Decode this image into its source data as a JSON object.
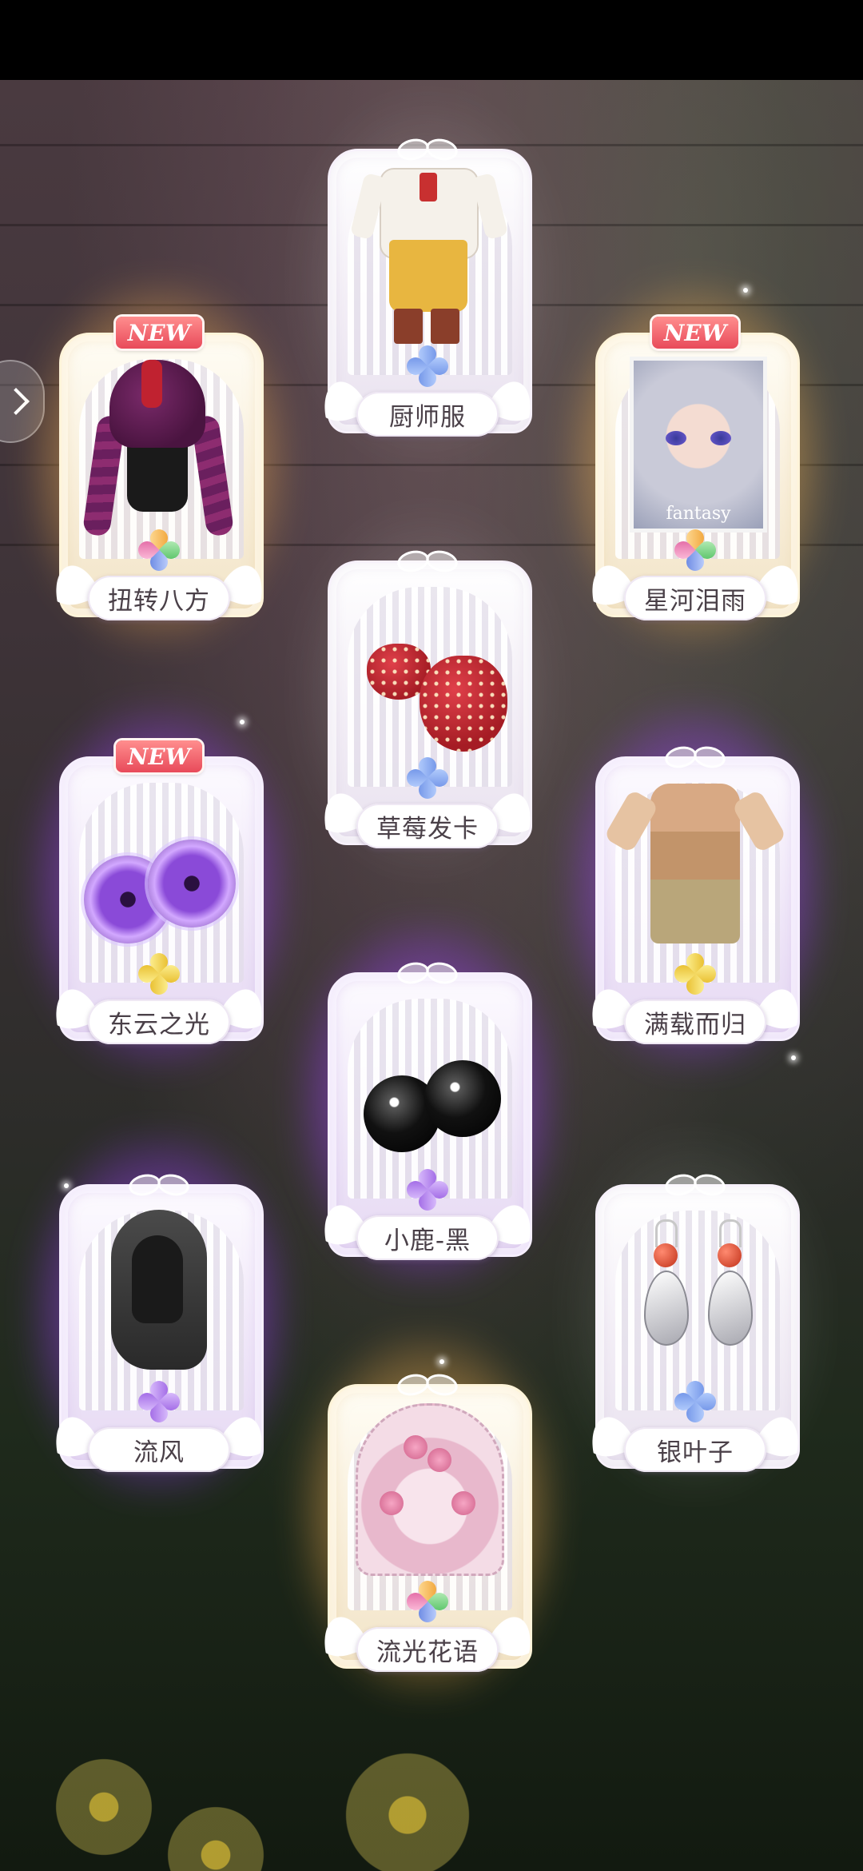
{
  "cards": [
    {
      "name": "扭转八方",
      "new": true,
      "tier": "gold",
      "rarity": "rainbow",
      "icon": "braided-hair-icon"
    },
    {
      "name": "厨师服",
      "new": false,
      "tier": "white",
      "rarity": "blue",
      "icon": "chef-outfit-icon"
    },
    {
      "name": "星河泪雨",
      "new": true,
      "tier": "gold",
      "rarity": "rainbow",
      "icon": "portrait-card-icon",
      "caption": "fantasy"
    },
    {
      "name": "草莓发卡",
      "new": false,
      "tier": "white",
      "rarity": "blue",
      "icon": "strawberry-hairpin-icon"
    },
    {
      "name": "东云之光",
      "new": true,
      "tier": "purple",
      "rarity": "gold",
      "icon": "purple-eyes-icon"
    },
    {
      "name": "满载而归",
      "new": false,
      "tier": "purple",
      "rarity": "gold",
      "icon": "brown-outfit-icon"
    },
    {
      "name": "小鹿-黑",
      "new": false,
      "tier": "purple",
      "rarity": "purple",
      "icon": "black-eyes-icon"
    },
    {
      "name": "流风",
      "new": false,
      "tier": "purple",
      "rarity": "purple",
      "icon": "gray-hair-icon"
    },
    {
      "name": "银叶子",
      "new": false,
      "tier": "white",
      "rarity": "blue",
      "icon": "silver-leaf-earrings-icon"
    },
    {
      "name": "流光花语",
      "new": false,
      "tier": "gold",
      "rarity": "rainbow",
      "icon": "rose-fan-icon"
    }
  ],
  "badge_new_label": "NEW",
  "colors": {
    "gold_glow": "#ffd278",
    "purple_glow": "#be6eff",
    "name_text": "#4a4048"
  }
}
